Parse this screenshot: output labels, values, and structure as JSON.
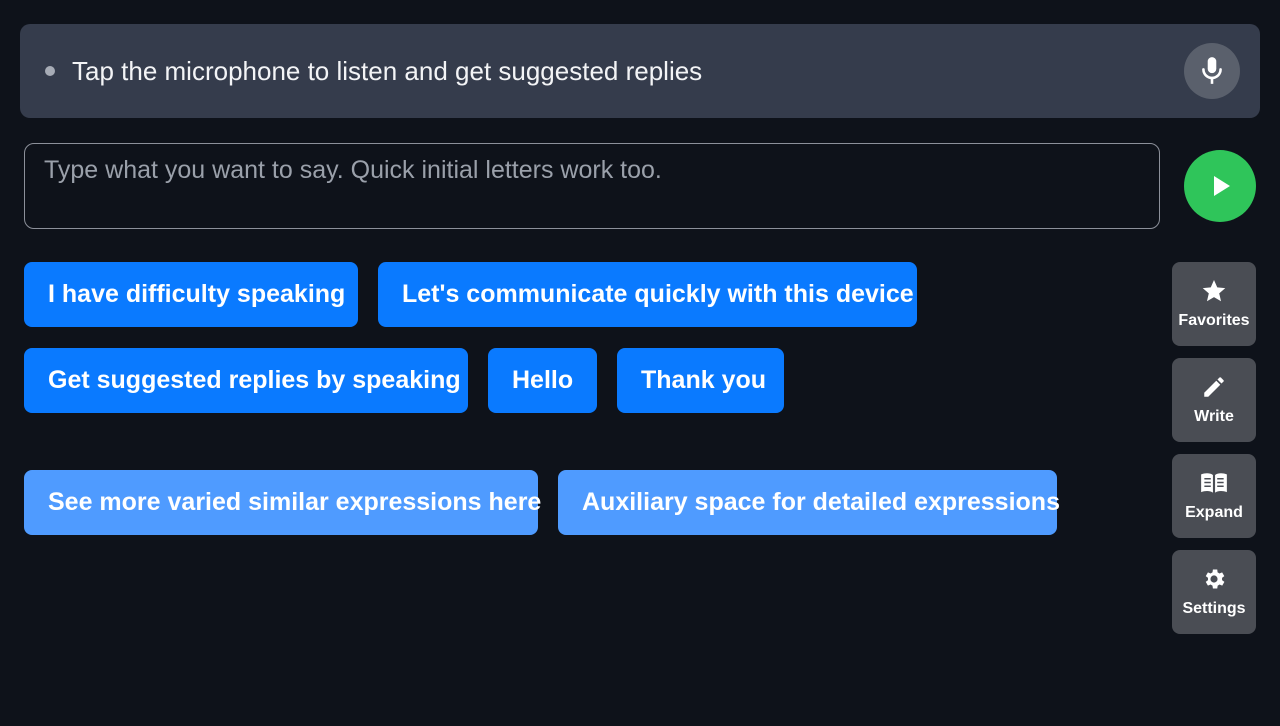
{
  "listen_bar": {
    "text": "Tap the microphone to listen and get suggested replies",
    "mic_icon": "microphone-icon"
  },
  "input": {
    "value": "",
    "placeholder": "Type what you want to say. Quick initial letters work too."
  },
  "speak_button": {
    "icon": "play-icon",
    "color": "#2fc55a"
  },
  "phrases": [
    "I have difficulty speaking",
    "Let's communicate quickly with this device",
    "Get suggested replies by speaking",
    "Hello",
    "Thank you"
  ],
  "helpers": [
    "See more varied similar expressions here",
    "Auxiliary space for detailed expressions"
  ],
  "side_menu": [
    {
      "label": "Favorites",
      "icon": "star-icon"
    },
    {
      "label": "Write",
      "icon": "pencil-icon"
    },
    {
      "label": "Expand",
      "icon": "book-icon"
    },
    {
      "label": "Settings",
      "icon": "gear-icon"
    }
  ],
  "colors": {
    "background": "#0e121a",
    "chip_primary": "#0a7aff",
    "chip_secondary": "#4f9bff",
    "side_button": "#4a4d54",
    "listen_bar": "#353c4c"
  }
}
